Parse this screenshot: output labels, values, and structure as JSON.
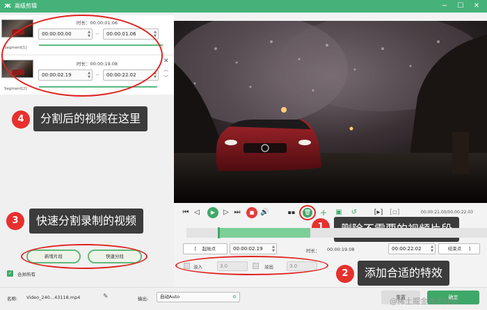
{
  "window": {
    "title": "高级剪辑",
    "logo_glyph": "ж",
    "minimize": "−",
    "maximize": "☐",
    "close": "✕"
  },
  "segments": [
    {
      "label": "Segment[1]",
      "duration_label": "时长：00:00:01.06",
      "start": "00:00:00.00",
      "end": "00:00:01.06"
    },
    {
      "label": "Segment[2]",
      "duration_label": "时长：00:00:19.08",
      "start": "00:00:02.19",
      "end": "00:00:22.02"
    }
  ],
  "annotations": {
    "a1": {
      "num": "1",
      "text": "删除不需要的视频片段"
    },
    "a2": {
      "num": "2",
      "text": "添加合适的特效"
    },
    "a3": {
      "num": "3",
      "text": "快速分割录制的视频"
    },
    "a4": {
      "num": "4",
      "text": "分割后的视频在这里"
    }
  },
  "left_buttons": {
    "new_segment": "新增片段",
    "quick_split": "快速分段",
    "merge_all": "合并所有"
  },
  "player": {
    "time_display": "00:00:21.00/00:00:22.03",
    "progress": 0.0
  },
  "trim_row": {
    "start_bracket": "[",
    "start_label": "起始点",
    "start_value": "00:00:02.19",
    "duration_label": "时长：",
    "duration_value": "00:00:19.08",
    "end_value": "00:00:22.02",
    "end_label": "结束点",
    "end_bracket": "]"
  },
  "effects": {
    "fade_in_label": "淡入",
    "fade_in_value": "3.0",
    "fade_out_label": "淡出",
    "fade_out_value": "3.0"
  },
  "bottom": {
    "name_label": "名称:",
    "name_value": "Video_240...43118.mp4",
    "output_label": "输出:",
    "output_value": "自动Auto",
    "reset_button": "重置",
    "ok_button": "确定"
  },
  "watermark": "@稀土掘金技术社区",
  "colors": {
    "accent": "#3fa868",
    "titlebar": "#45b27a",
    "annotation_red": "#e8302d",
    "annotation_box": "#3c3c3c"
  }
}
